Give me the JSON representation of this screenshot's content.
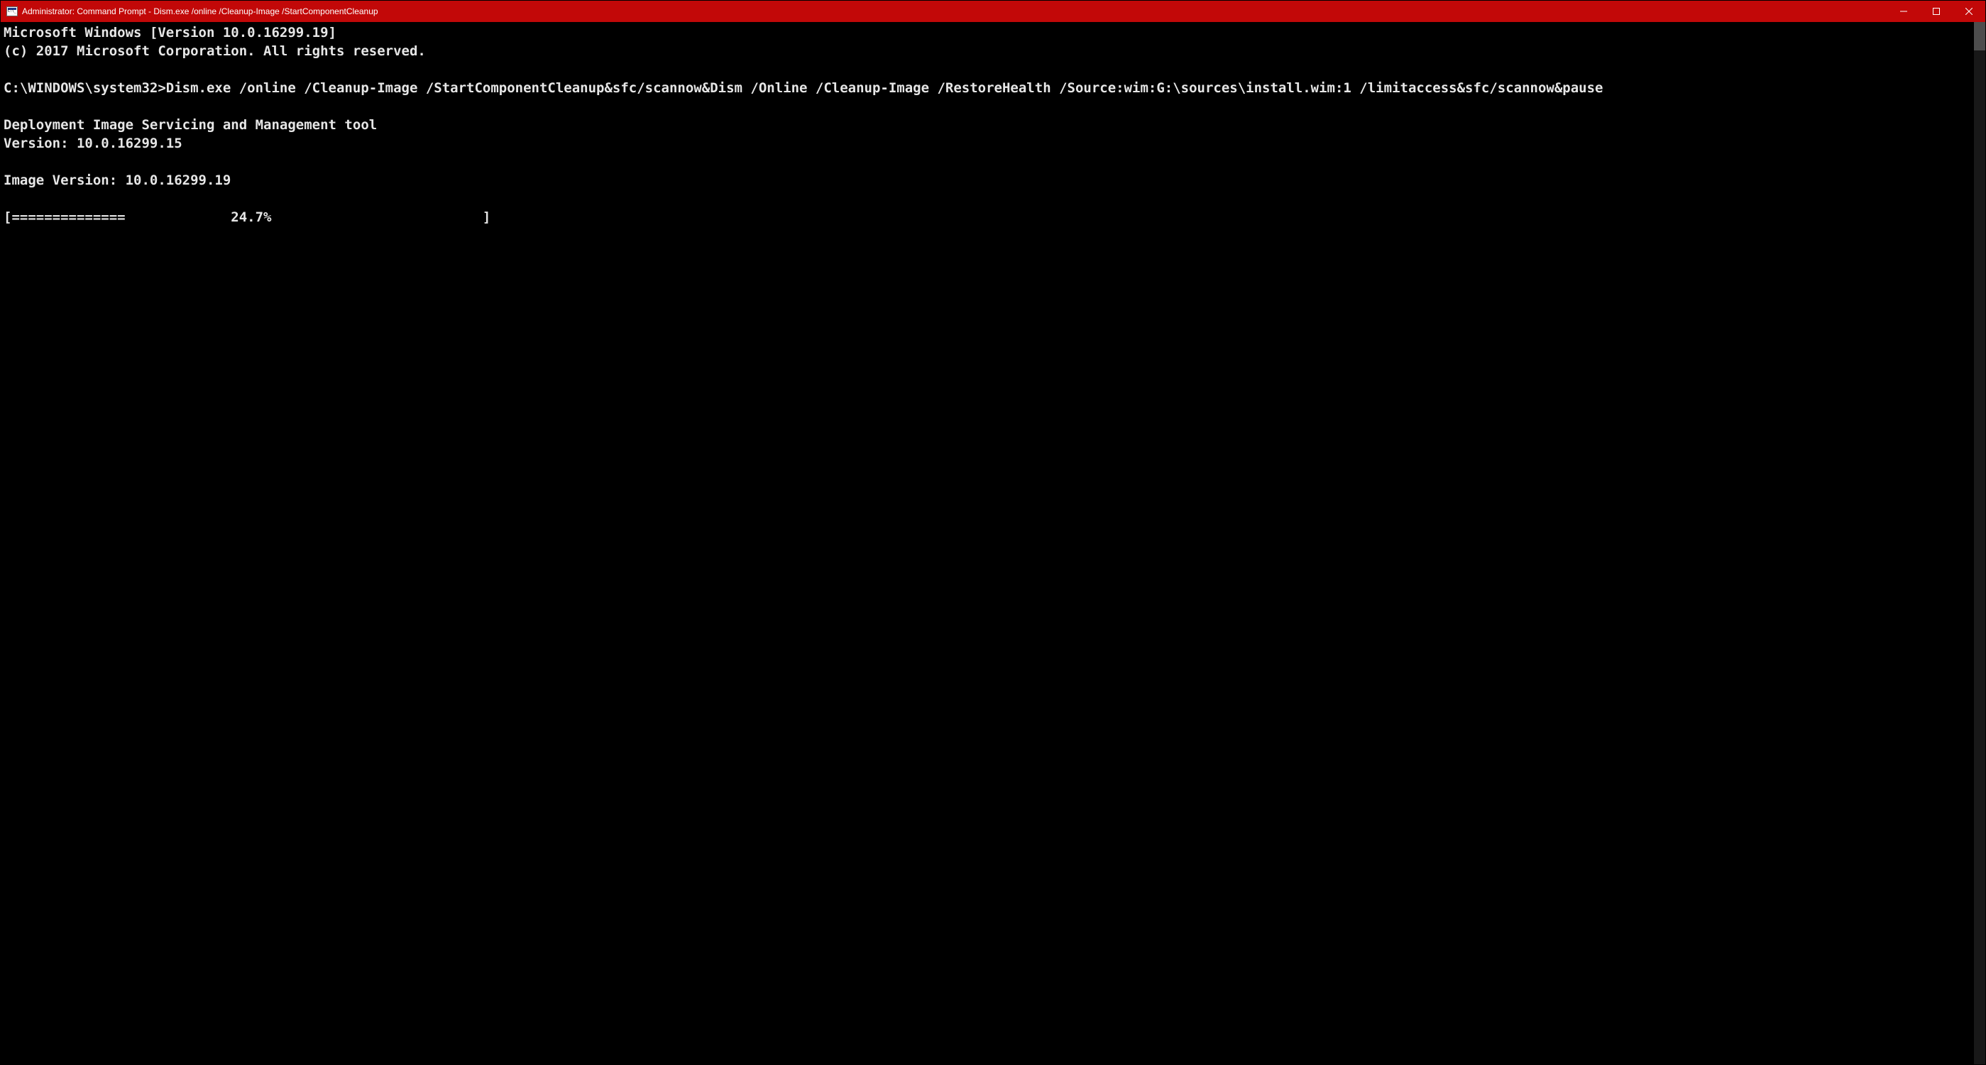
{
  "titlebar": {
    "title": "Administrator: Command Prompt - Dism.exe  /online /Cleanup-Image /StartComponentCleanup"
  },
  "terminal": {
    "line_version": "Microsoft Windows [Version 10.0.16299.19]",
    "line_copyright": "(c) 2017 Microsoft Corporation. All rights reserved.",
    "blank1": "",
    "prompt_line": "C:\\WINDOWS\\system32>Dism.exe /online /Cleanup-Image /StartComponentCleanup&sfc/scannow&Dism /Online /Cleanup-Image /RestoreHealth /Source:wim:G:\\sources\\install.wim:1 /limitaccess&sfc/scannow&pause",
    "blank2": "",
    "dism_title": "Deployment Image Servicing and Management tool",
    "dism_version": "Version: 10.0.16299.15",
    "blank3": "",
    "image_version": "Image Version: 10.0.16299.19",
    "blank4": "",
    "progress_line": "[==============             24.7%                          ] "
  }
}
